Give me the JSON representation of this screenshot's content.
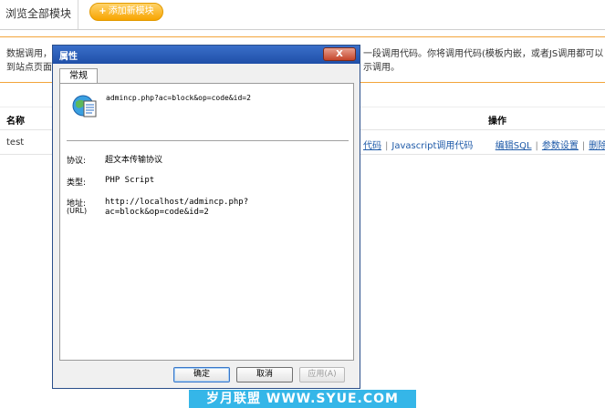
{
  "page": {
    "tab_all": "浏览全部模块",
    "add_button": "添加新模块",
    "add_icon": "plus-icon",
    "desc_left_line1": "数据调用，",
    "desc_left_line2": "到站点页面",
    "desc_right_line1": "一段调用代码。你将调用代码(模板内嵌，或者JS调用都可以",
    "desc_right_line2": "示调用。",
    "col_name": "名称",
    "col_operation": "操作",
    "row": {
      "name": "test",
      "link_code_tail": "代码",
      "link_js": "Javascript调用代码",
      "link_edit_sql": "编辑SQL",
      "link_params": "参数设置",
      "link_delete": "删除"
    },
    "colors": {
      "accent": "#f3a53a",
      "link": "#1e5aa8"
    }
  },
  "dialog": {
    "title": "属性",
    "close_label": "X",
    "tab": "常规",
    "icon": "ie-document-icon",
    "address_short": "admincp.php?ac=block&op=code&id=2",
    "protocol_label": "协议:",
    "protocol_value": "超文本传输协议",
    "type_label": "类型:",
    "type_value": "PHP Script",
    "address_label": "地址:",
    "address_label_sub": "(URL)",
    "address_line1": "http://localhost/admincp.php?",
    "address_line2": "ac=block&op=code&id=2",
    "ok": "确定",
    "cancel": "取消",
    "apply": "应用(A)"
  },
  "watermark": "岁月联盟 WWW.SYUE.COM"
}
